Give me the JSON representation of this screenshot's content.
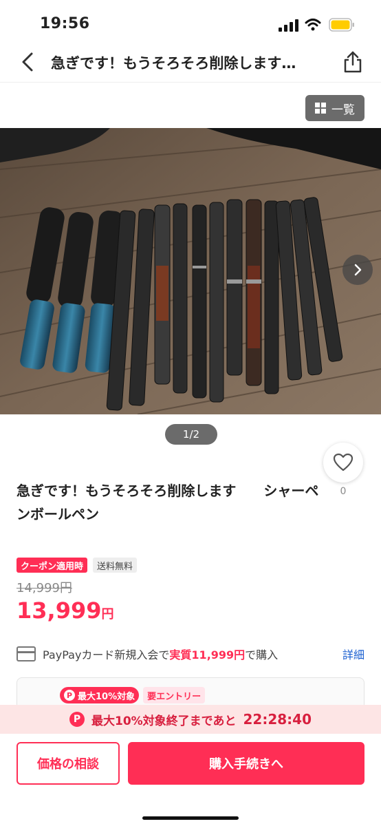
{
  "status": {
    "time": "19:56",
    "battery_color": "#ffcc00"
  },
  "nav": {
    "title": "急ぎです！もうそろそろ削除します…"
  },
  "gallery": {
    "list_label": "一覧",
    "pager": "1/2"
  },
  "item": {
    "title": "急ぎです！もうそろそろ削除します　　シャーペンボールペン",
    "like_count": "0"
  },
  "pricing": {
    "coupon_badge": "クーポン適用時",
    "shipping_badge": "送料無料",
    "original_price": "14,999円",
    "price_number": "13,999",
    "price_unit": "円"
  },
  "paypay_card": {
    "prefix": "PayPayカード新規入会で",
    "highlight": "実質11,999円",
    "suffix": "で購入",
    "detail_link": "詳細"
  },
  "promo": {
    "max_tag": "最大10%対象",
    "entry_tag": "要エントリー"
  },
  "countdown": {
    "label": "最大10%対象終了まであと",
    "time": "22:28:40"
  },
  "actions": {
    "negotiate": "価格の相談",
    "buy": "購入手続きへ"
  },
  "colors": {
    "accent": "#ff2e55",
    "link": "#1a5fd0"
  }
}
